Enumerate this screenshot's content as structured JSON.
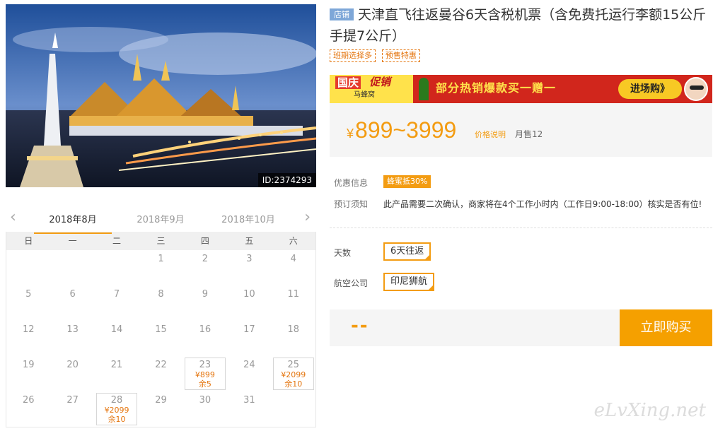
{
  "photo": {
    "id_label": "ID:2374293"
  },
  "calendar": {
    "months": [
      "2018年8月",
      "2018年9月",
      "2018年10月"
    ],
    "active_month": 0,
    "weekdays": [
      "日",
      "一",
      "二",
      "三",
      "四",
      "五",
      "六"
    ],
    "lead_blanks": 3,
    "days_in_month": 31,
    "available": {
      "23": {
        "price": "¥899",
        "stock": "余5"
      },
      "25": {
        "price": "¥2099",
        "stock": "余10"
      },
      "28": {
        "price": "¥2099",
        "stock": "余10"
      }
    }
  },
  "product": {
    "store_badge": "店铺",
    "title": "天津直飞往返曼谷6天含税机票（含免费托运行李额15公斤手提7公斤）",
    "tags": [
      "班期选择多",
      "预售特惠"
    ]
  },
  "banner": {
    "left_a": "国庆",
    "left_b": "促销",
    "brand": "马蜂窝",
    "slogan": "部分热销爆款买一赠一",
    "cta": "进场购》"
  },
  "price": {
    "yen": "¥",
    "range": "899~3999",
    "note_link": "价格说明",
    "sold": "月售12"
  },
  "info": {
    "promo_label": "优惠信息",
    "promo_badge": "蜂蜜抵30%",
    "booking_label": "预订须知",
    "booking_text": "此产品需要二次确认，商家将在4个工作小时内（工作日9:00-18:00）核实是否有位!"
  },
  "options": {
    "days_label": "天数",
    "days_value": "6天往返",
    "airline_label": "航空公司",
    "airline_value": "印尼狮航"
  },
  "purchase": {
    "placeholder": "--",
    "buy_label": "立即购买"
  },
  "watermark": "eLvXing.net",
  "colors": {
    "accent": "#f39c12",
    "buy": "#f5a000",
    "badge": "#7ea7d8"
  }
}
